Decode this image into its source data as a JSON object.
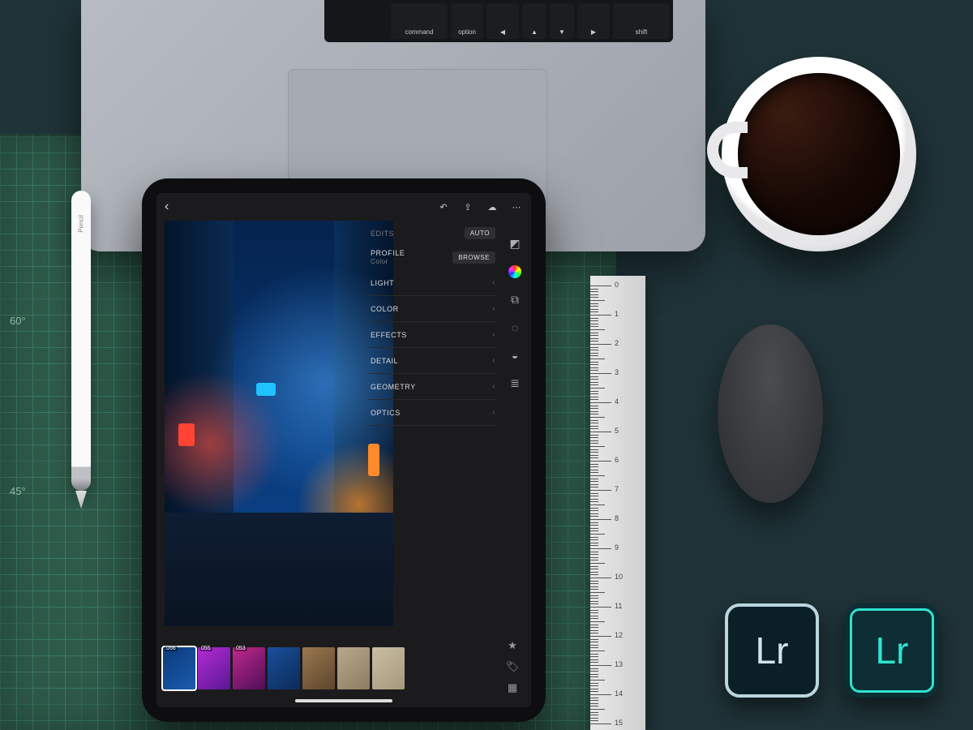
{
  "laptop_keys": [
    "command",
    "option",
    "◀",
    "▲",
    "▼",
    "▶",
    "shift"
  ],
  "pencil_brand": " Pencil",
  "mat_angles": [
    "60°",
    "45°"
  ],
  "lr": {
    "top_tab": "EDITS",
    "panel_header": "PROFILE",
    "panel_sub": "Color",
    "auto_btn": "AUTO",
    "browse_btn": "BROWSE",
    "sections": [
      "LIGHT",
      "COLOR",
      "EFFECTS",
      "DETAIL",
      "GEOMETRY",
      "OPTICS"
    ],
    "thumbs": [
      {
        "label": "056",
        "bg": "linear-gradient(140deg,#0a3a78,#1b5bb0)"
      },
      {
        "label": "055",
        "bg": "linear-gradient(140deg,#b32bd6,#5a1893)"
      },
      {
        "label": "053",
        "bg": "linear-gradient(140deg,#c1288e,#4d0f55)"
      },
      {
        "label": "",
        "bg": "linear-gradient(140deg,#1a4f9a,#0b2b5a)"
      },
      {
        "label": "",
        "bg": "linear-gradient(140deg,#9a7850,#5c452c)"
      },
      {
        "label": "",
        "bg": "linear-gradient(140deg,#b8a88c,#8d7c60)"
      },
      {
        "label": "",
        "bg": "linear-gradient(140deg,#cabfa4,#a6987a)"
      }
    ]
  },
  "app_icons": {
    "label": "Lr"
  },
  "ruler_max_cm": 15
}
